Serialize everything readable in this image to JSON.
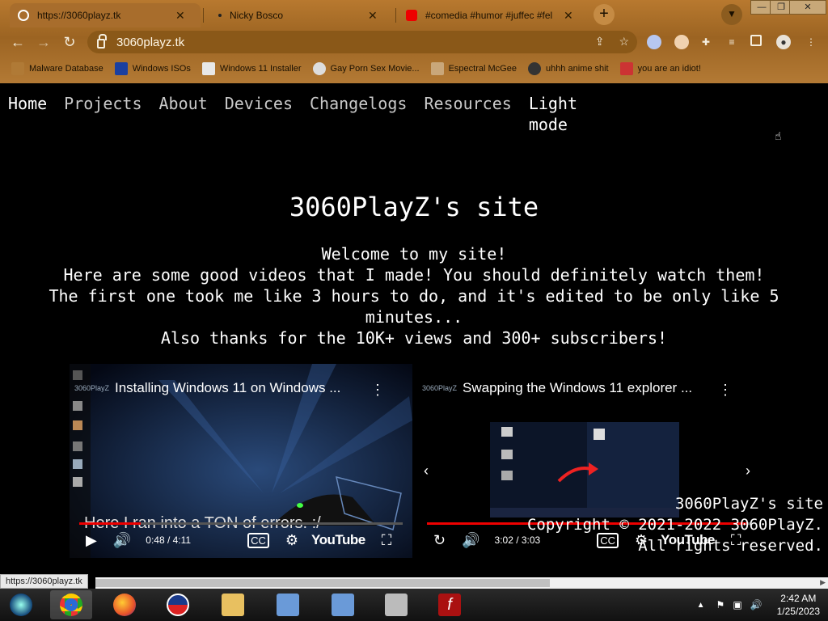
{
  "browser": {
    "tabs": [
      {
        "title": "https://3060playz.tk",
        "active": true
      },
      {
        "title": "Nicky Bosco",
        "active": false
      },
      {
        "title": "#comedia #humor #juffec #fel",
        "active": false
      }
    ],
    "window_controls": {
      "minimize": "—",
      "restore": "❐",
      "close": "✕"
    },
    "address": "3060playz.tk",
    "bookmarks": [
      "Malware Database",
      "Windows ISOs",
      "Windows 11 Installer",
      "Gay Porn Sex Movie...",
      "Espectral McGee",
      "uhhh anime shit",
      "you are an idiot!"
    ]
  },
  "page": {
    "nav": [
      "Home",
      "Projects",
      "About",
      "Devices",
      "Changelogs",
      "Resources",
      "Light mode"
    ],
    "title": "3060PlayZ's site",
    "intro_lines": [
      "Welcome to my site!",
      "Here are some good videos that I made! You should definitely watch them!",
      "The first one took me like 3 hours to do, and it's edited to be only like 5 minutes...",
      "Also thanks for the 10K+ views and 300+ subscribers!"
    ],
    "videos": [
      {
        "channel": "3060PlayZ",
        "title": "Installing Windows 11 on Windows ...",
        "caption": "Here I ran into a TON of errors. :/",
        "time": "0:48 / 4:11",
        "progress": 0.19,
        "brand": "YouTube"
      },
      {
        "channel": "3060PlayZ",
        "title": "Swapping the Windows 11 explorer ...",
        "time": "3:02 / 3:03",
        "progress": 0.99,
        "brand": "YouTube"
      }
    ],
    "footer": [
      "3060PlayZ's site",
      "Copyright © 2021-2022 3060PlayZ.",
      "All rights reserved."
    ]
  },
  "status_url": "https://3060playz.tk",
  "taskbar": {
    "clock_time": "2:42 AM",
    "clock_date": "1/25/2023"
  },
  "colors": {
    "chrome_brown": "#9c6422",
    "accent_red": "#e00000",
    "page_bg": "#000000"
  }
}
